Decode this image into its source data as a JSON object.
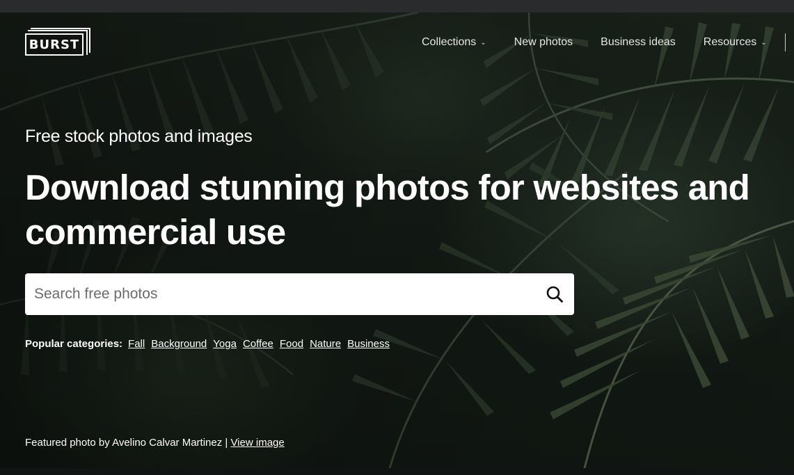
{
  "header": {
    "logo_text": "BURST",
    "nav": [
      {
        "label": "Collections",
        "has_dropdown": true
      },
      {
        "label": "New photos",
        "has_dropdown": false
      },
      {
        "label": "Business ideas",
        "has_dropdown": false
      },
      {
        "label": "Resources",
        "has_dropdown": true
      }
    ]
  },
  "hero": {
    "kicker": "Free stock photos and images",
    "headline": "Download stunning photos for websites and commercial use"
  },
  "search": {
    "placeholder": "Search free photos",
    "value": "",
    "icon": "search-icon"
  },
  "popular": {
    "label": "Popular categories:",
    "categories": [
      "Fall",
      "Background",
      "Yoga",
      "Coffee",
      "Food",
      "Nature",
      "Business"
    ]
  },
  "credit": {
    "text": "Featured photo by Avelino Calvar Martinez |",
    "link": "View image"
  },
  "colors": {
    "text": "#ffffff",
    "search_bg": "#ffffff",
    "top_strip": "#2a2b2d"
  }
}
